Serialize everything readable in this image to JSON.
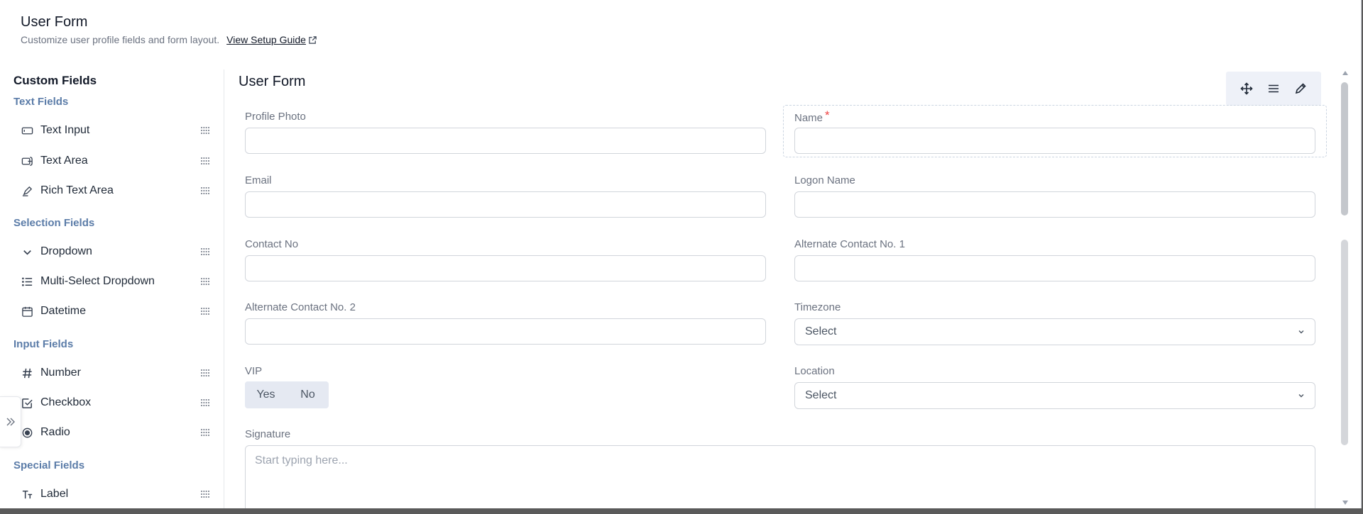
{
  "header": {
    "title": "User Form",
    "subtitle": "Customize user profile fields and form layout.",
    "guide_link": "View Setup Guide"
  },
  "sidebar": {
    "title": "Custom Fields",
    "groups": [
      {
        "label": "Text Fields",
        "items": [
          {
            "label": "Text Input",
            "icon": "text-input-icon"
          },
          {
            "label": "Text Area",
            "icon": "text-area-icon"
          },
          {
            "label": "Rich Text Area",
            "icon": "rich-text-icon"
          }
        ]
      },
      {
        "label": "Selection Fields",
        "items": [
          {
            "label": "Dropdown",
            "icon": "chevron-down-icon"
          },
          {
            "label": "Multi-Select Dropdown",
            "icon": "list-icon"
          },
          {
            "label": "Datetime",
            "icon": "calendar-icon"
          }
        ]
      },
      {
        "label": "Input Fields",
        "items": [
          {
            "label": "Number",
            "icon": "hash-icon"
          },
          {
            "label": "Checkbox",
            "icon": "checkbox-icon"
          },
          {
            "label": "Radio",
            "icon": "radio-icon"
          }
        ]
      },
      {
        "label": "Special Fields",
        "items": [
          {
            "label": "Label",
            "icon": "label-icon"
          }
        ]
      }
    ]
  },
  "form": {
    "title": "User Form",
    "fields": {
      "profile_photo": {
        "label": "Profile Photo",
        "value": ""
      },
      "name": {
        "label": "Name",
        "required_mark": "*",
        "value": ""
      },
      "email": {
        "label": "Email",
        "value": ""
      },
      "logon_name": {
        "label": "Logon Name",
        "value": ""
      },
      "contact_no": {
        "label": "Contact No",
        "value": ""
      },
      "alt_contact_1": {
        "label": "Alternate Contact No. 1",
        "value": ""
      },
      "alt_contact_2": {
        "label": "Alternate Contact No. 2",
        "value": ""
      },
      "timezone": {
        "label": "Timezone",
        "selected": "Select"
      },
      "vip": {
        "label": "VIP",
        "option_yes": "Yes",
        "option_no": "No"
      },
      "location": {
        "label": "Location",
        "selected": "Select"
      },
      "signature": {
        "label": "Signature",
        "placeholder": "Start typing here..."
      }
    }
  },
  "colors": {
    "accent_group": "#5b7ca8",
    "required": "#ef4444",
    "toolbar_bg": "#eef1f8"
  }
}
